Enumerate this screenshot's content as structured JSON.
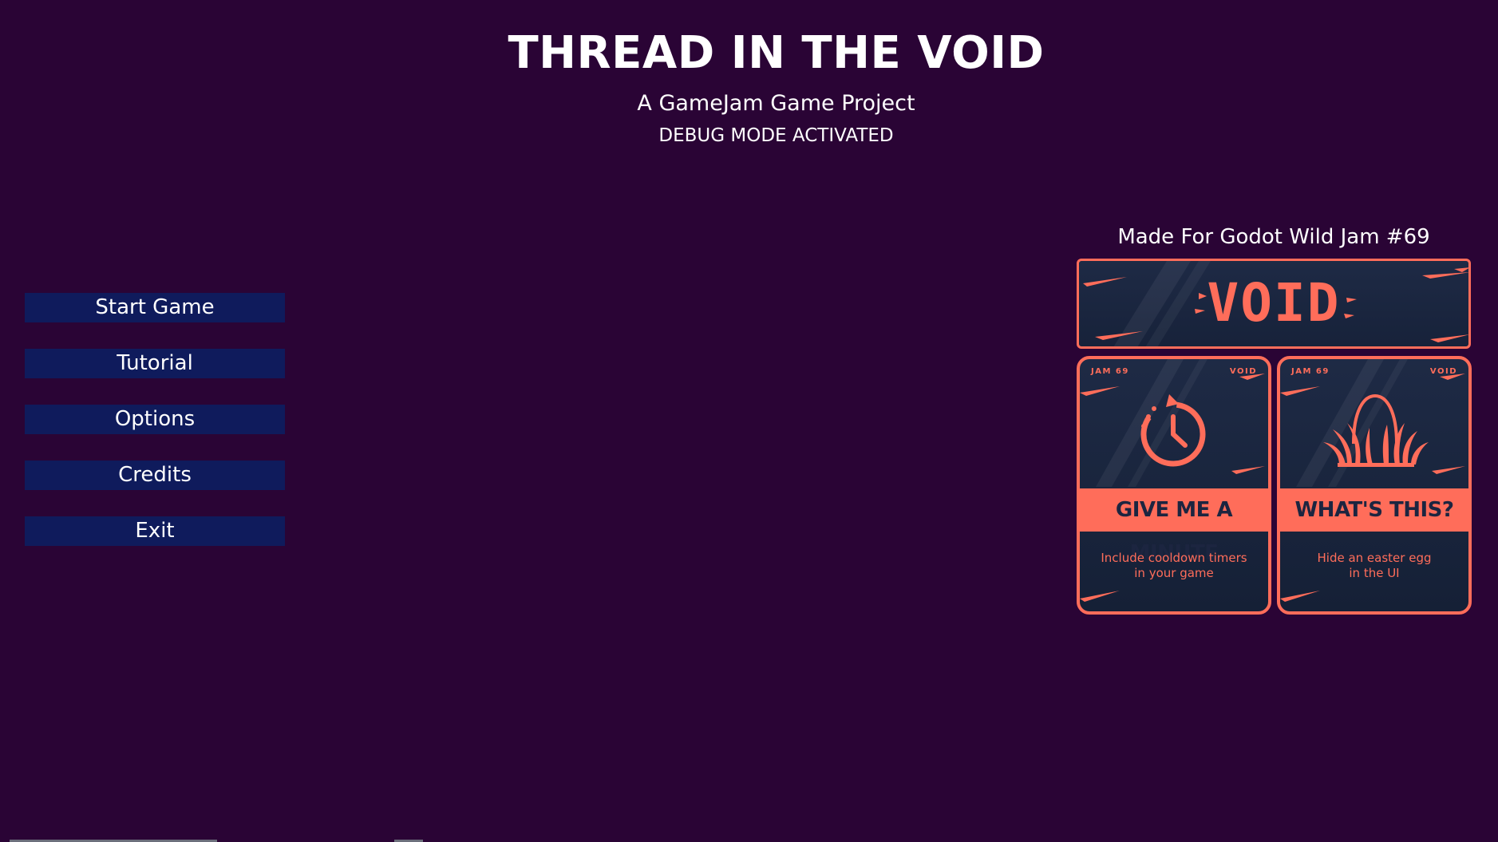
{
  "header": {
    "title": "THREAD IN THE VOID",
    "subtitle": "A GameJam Game Project",
    "debug": "DEBUG MODE ACTIVATED"
  },
  "menu": {
    "start": "Start Game",
    "tutorial": "Tutorial",
    "options": "Options",
    "credits": "Credits",
    "exit": "Exit"
  },
  "jam": {
    "label": "Made For Godot Wild Jam #69",
    "theme_word": "VOID",
    "accent_color": "#ff6d5a",
    "card_bg_color": "#1e2a45",
    "cards": [
      {
        "corner_left": "JAM 69",
        "corner_right": "VOID",
        "icon": "stopwatch-icon",
        "title": "GIVE ME A MINUTE",
        "desc_line1": "Include cooldown timers",
        "desc_line2": "in your game"
      },
      {
        "corner_left": "JAM 69",
        "corner_right": "VOID",
        "icon": "egg-in-grass-icon",
        "title": "WHAT'S THIS?",
        "desc_line1": "Hide an easter egg",
        "desc_line2": "in the UI"
      }
    ]
  },
  "colors": {
    "background": "#2a0435",
    "button": "#0f1b5c"
  }
}
